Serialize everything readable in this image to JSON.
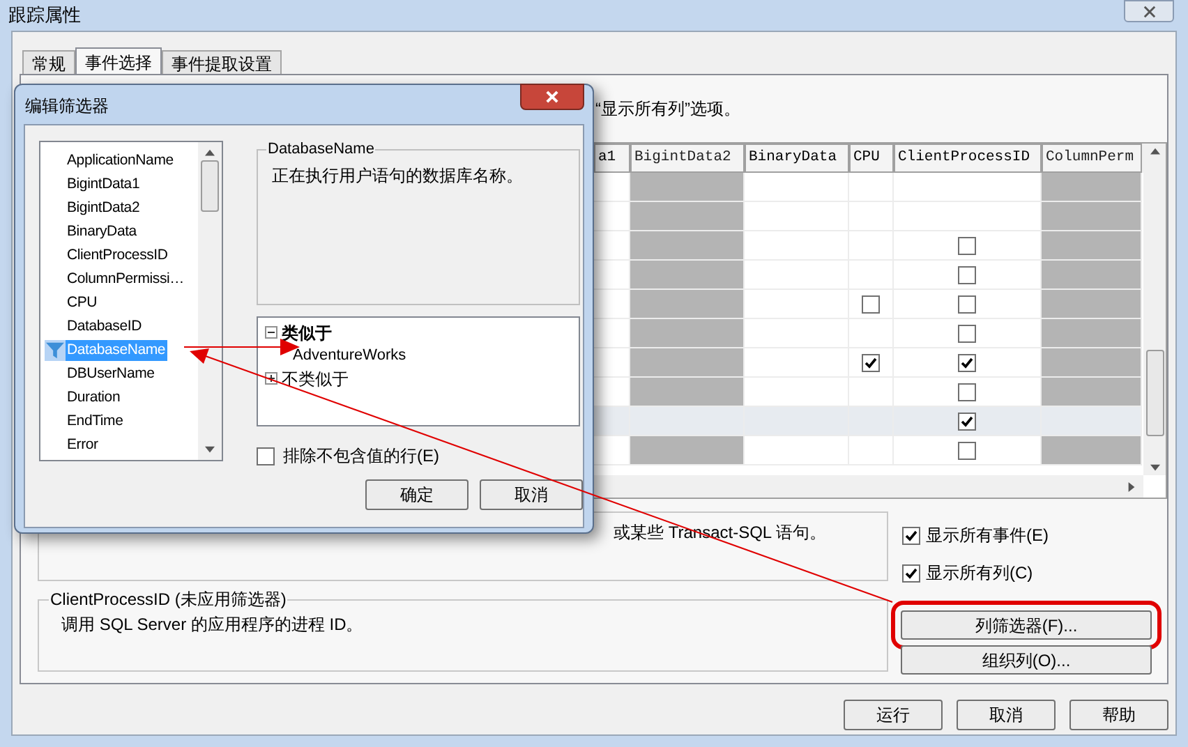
{
  "window": {
    "title": "跟踪属性"
  },
  "tabs": [
    {
      "label": "常规",
      "selected": false
    },
    {
      "label": "事件选择",
      "selected": true
    },
    {
      "label": "事件提取设置",
      "selected": false
    }
  ],
  "hint_text": "“显示所有列”选项。",
  "grid": {
    "columns": [
      {
        "label": "a1",
        "available": true
      },
      {
        "label": "BigintData2",
        "available": false
      },
      {
        "label": "BinaryData",
        "available": true
      },
      {
        "label": "CPU",
        "available": true
      },
      {
        "label": "ClientProcessID",
        "available": true
      },
      {
        "label": "ColumnPerm",
        "available": false
      }
    ],
    "rows": [
      {
        "selected": false
      },
      {
        "selected": false
      },
      {
        "selected": false,
        "client_process_id": {
          "checked": false
        }
      },
      {
        "selected": false,
        "client_process_id": {
          "checked": false
        }
      },
      {
        "selected": false,
        "cpu": {
          "checked": false
        },
        "client_process_id": {
          "checked": false
        }
      },
      {
        "selected": false,
        "client_process_id": {
          "checked": false
        }
      },
      {
        "selected": false,
        "cpu": {
          "checked": true
        },
        "client_process_id": {
          "checked": true
        }
      },
      {
        "selected": false,
        "client_process_id": {
          "checked": false
        }
      },
      {
        "selected": true,
        "client_process_id": {
          "checked": true
        }
      },
      {
        "selected": false,
        "client_process_id": {
          "checked": false
        }
      }
    ]
  },
  "event_description": "或某些 Transact-SQL 语句。",
  "options": [
    {
      "label": "显示所有事件(E)",
      "checked": true
    },
    {
      "label": "显示所有列(C)",
      "checked": true
    }
  ],
  "column_info": {
    "title": "ClientProcessID (未应用筛选器)",
    "text": "调用 SQL Server 的应用程序的进程 ID。"
  },
  "column_buttons": [
    {
      "label": "列筛选器(F)...",
      "highlighted": true
    },
    {
      "label": "组织列(O)...",
      "highlighted": false
    }
  ],
  "buttons": [
    "运行",
    "取消",
    "帮助"
  ],
  "filter_dialog": {
    "title": "编辑筛选器",
    "columns": [
      {
        "label": "ApplicationName",
        "selected": false,
        "filtered": false
      },
      {
        "label": "BigintData1",
        "selected": false,
        "filtered": false
      },
      {
        "label": "BigintData2",
        "selected": false,
        "filtered": false
      },
      {
        "label": "BinaryData",
        "selected": false,
        "filtered": false
      },
      {
        "label": "ClientProcessID",
        "selected": false,
        "filtered": false
      },
      {
        "label": "ColumnPermissi…",
        "selected": false,
        "filtered": false
      },
      {
        "label": "CPU",
        "selected": false,
        "filtered": false
      },
      {
        "label": "DatabaseID",
        "selected": false,
        "filtered": false
      },
      {
        "label": "DatabaseName",
        "selected": true,
        "filtered": true
      },
      {
        "label": "DBUserName",
        "selected": false,
        "filtered": false
      },
      {
        "label": "Duration",
        "selected": false,
        "filtered": false
      },
      {
        "label": "EndTime",
        "selected": false,
        "filtered": false
      },
      {
        "label": "Error",
        "selected": false,
        "filtered": false
      }
    ],
    "description": {
      "title": "DatabaseName",
      "text": "正在执行用户语句的数据库名称。"
    },
    "tree": [
      {
        "label": "类似于",
        "expanded": true,
        "children": [
          {
            "label": "AdventureWorks"
          }
        ]
      },
      {
        "label": "不类似于",
        "expanded": false
      }
    ],
    "exclude_empty": {
      "label": "排除不包含值的行(E)",
      "checked": false
    },
    "buttons": [
      "确定",
      "取消"
    ]
  }
}
